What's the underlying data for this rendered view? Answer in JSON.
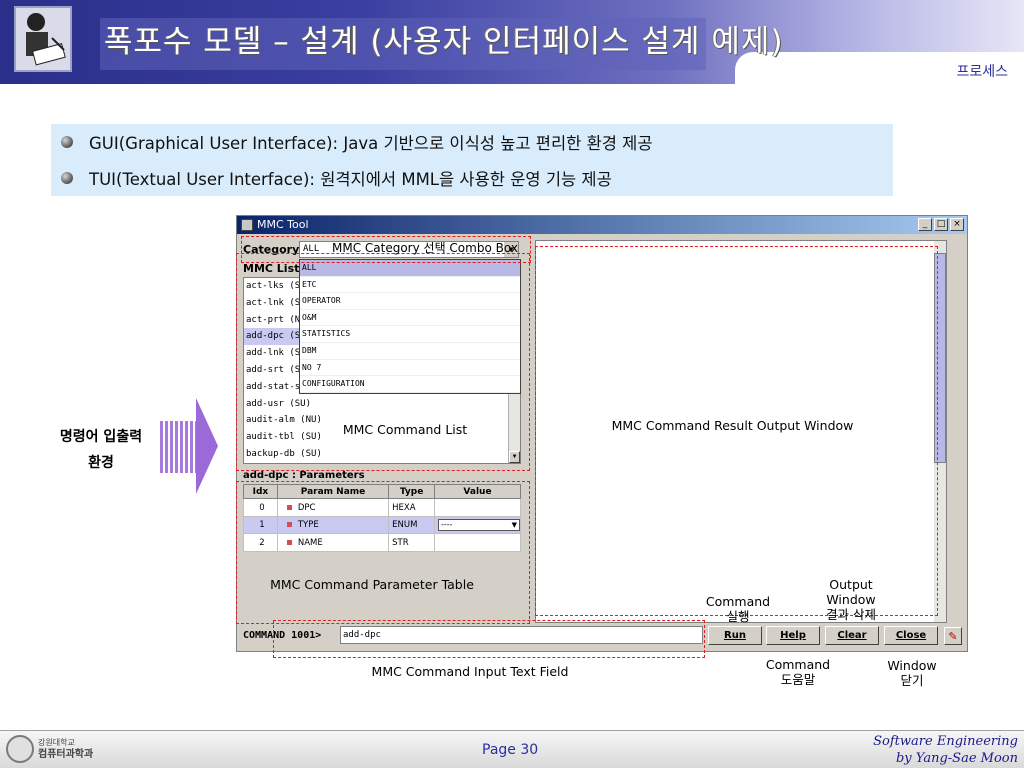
{
  "header": {
    "title": "폭포수 모델 – 설계 (사용자 인터페이스 설계 예제)",
    "breadcrumb": "프로세스"
  },
  "bullets": [
    "GUI(Graphical User Interface): Java 기반으로 이식성 높고 편리한 환경 제공",
    "TUI(Textual User Interface): 원격지에서 MML을 사용한 운영 기능 제공"
  ],
  "mmc": {
    "window_title": "MMC Tool",
    "window_buttons": [
      "_",
      "□",
      "×"
    ],
    "category_label": "Category",
    "category_value": "ALL",
    "category_options": [
      "ALL",
      "ETC",
      "OPERATOR",
      "O&M",
      "STATISTICS",
      "DBM",
      "NO 7",
      "CONFIGURATION"
    ],
    "list_label": "MMC List",
    "commands": [
      "act-lks (SU)",
      "act-lnk (SU)",
      "act-prt (NU)",
      "add-dpc (SU)",
      "add-lnk (SU)",
      "add-srt (SU)",
      "add-stat-sc",
      "add-usr (SU)",
      "audit-alm (NU)",
      "audit-tbl (SU)",
      "backup-db (SU)"
    ],
    "selected_command_index": 3,
    "params_title": "add-dpc : Parameters",
    "param_headers": [
      "Idx",
      "Param Name",
      "Type",
      "Value"
    ],
    "params": [
      {
        "idx": "0",
        "name": "DPC",
        "type": "HEXA",
        "value": ""
      },
      {
        "idx": "1",
        "name": "TYPE",
        "type": "ENUM",
        "value": "----"
      },
      {
        "idx": "2",
        "name": "NAME",
        "type": "STR",
        "value": ""
      }
    ],
    "command_label": "COMMAND 1001>",
    "command_value": "add-dpc",
    "buttons": {
      "run": "Run",
      "help": "Help",
      "clear": "Clear",
      "close": "Close"
    }
  },
  "annotations": {
    "combo": "MMC Category 선택 Combo Box",
    "command_list": "MMC Command List",
    "result_window": "MMC Command Result Output Window",
    "param_table": "MMC Command Parameter Table",
    "input_field": "MMC Command Input Text Field",
    "run_line1": "Command",
    "run_line2": "실행",
    "help_line1": "Command",
    "help_line2": "도움말",
    "clear_line1": "Output",
    "clear_line2": "Window",
    "clear_line3": "결과 삭제",
    "close_line1": "Window",
    "close_line2": "닫기"
  },
  "side_label": {
    "line1": "명령어 입출력",
    "line2": "환경"
  },
  "footer": {
    "school_line1": "강원대학교",
    "school_line2": "컴퓨터과학과",
    "page": "Page 30",
    "credit_line1": "Software Engineering",
    "credit_line2": "by Yang-Sae Moon"
  },
  "colors": {
    "header_dark": "#2a2f8a",
    "info_bg": "#d8ecfb",
    "annotation_dash": "#e02020",
    "arrow": "#9b6ad8"
  }
}
